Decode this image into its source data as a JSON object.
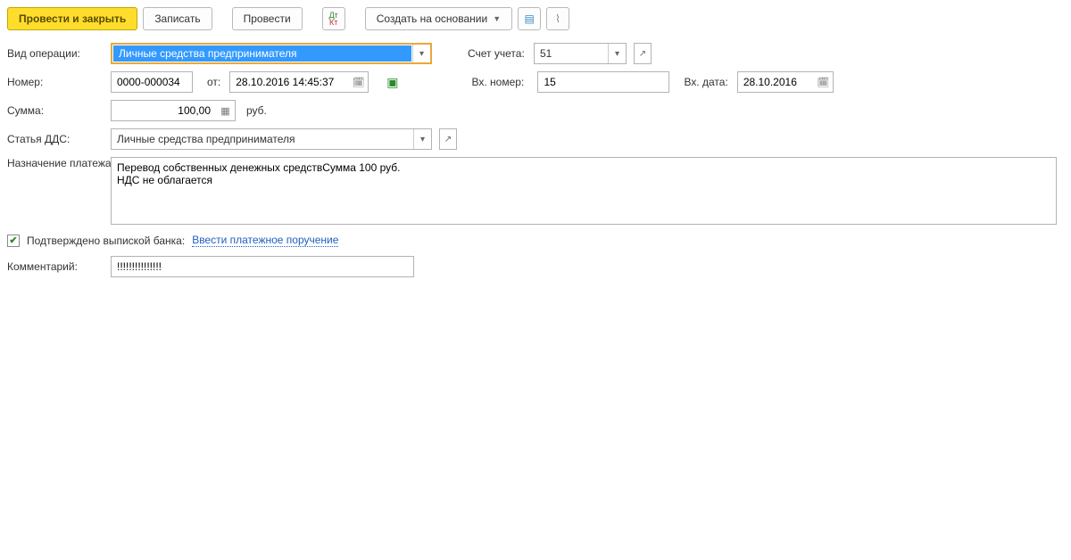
{
  "toolbar": {
    "post_close": "Провести и закрыть",
    "save": "Записать",
    "post": "Провести",
    "create_based": "Создать на основании"
  },
  "labels": {
    "operation_type": "Вид операции:",
    "account": "Счет учета:",
    "number": "Номер:",
    "from": "от:",
    "in_number": "Вх. номер:",
    "in_date": "Вх. дата:",
    "amount": "Сумма:",
    "currency": "руб.",
    "dds": "Статья ДДС:",
    "purpose": "Назначение платежа:",
    "confirmed": "Подтверждено выпиской банка:",
    "enter_order": "Ввести платежное поручение",
    "comment": "Комментарий:"
  },
  "fields": {
    "operation_type": "Личные средства предпринимателя",
    "account": "51",
    "number": "0000-000034",
    "date": "28.10.2016 14:45:37",
    "in_number": "15",
    "in_date": "28.10.2016",
    "amount": "100,00",
    "dds": "Личные средства предпринимателя",
    "purpose": "Перевод собственных денежных средствСумма 100 руб.\nНДС не облагается",
    "comment": "!!!!!!!!!!!!!!!"
  },
  "checked": {
    "confirmed": true
  }
}
